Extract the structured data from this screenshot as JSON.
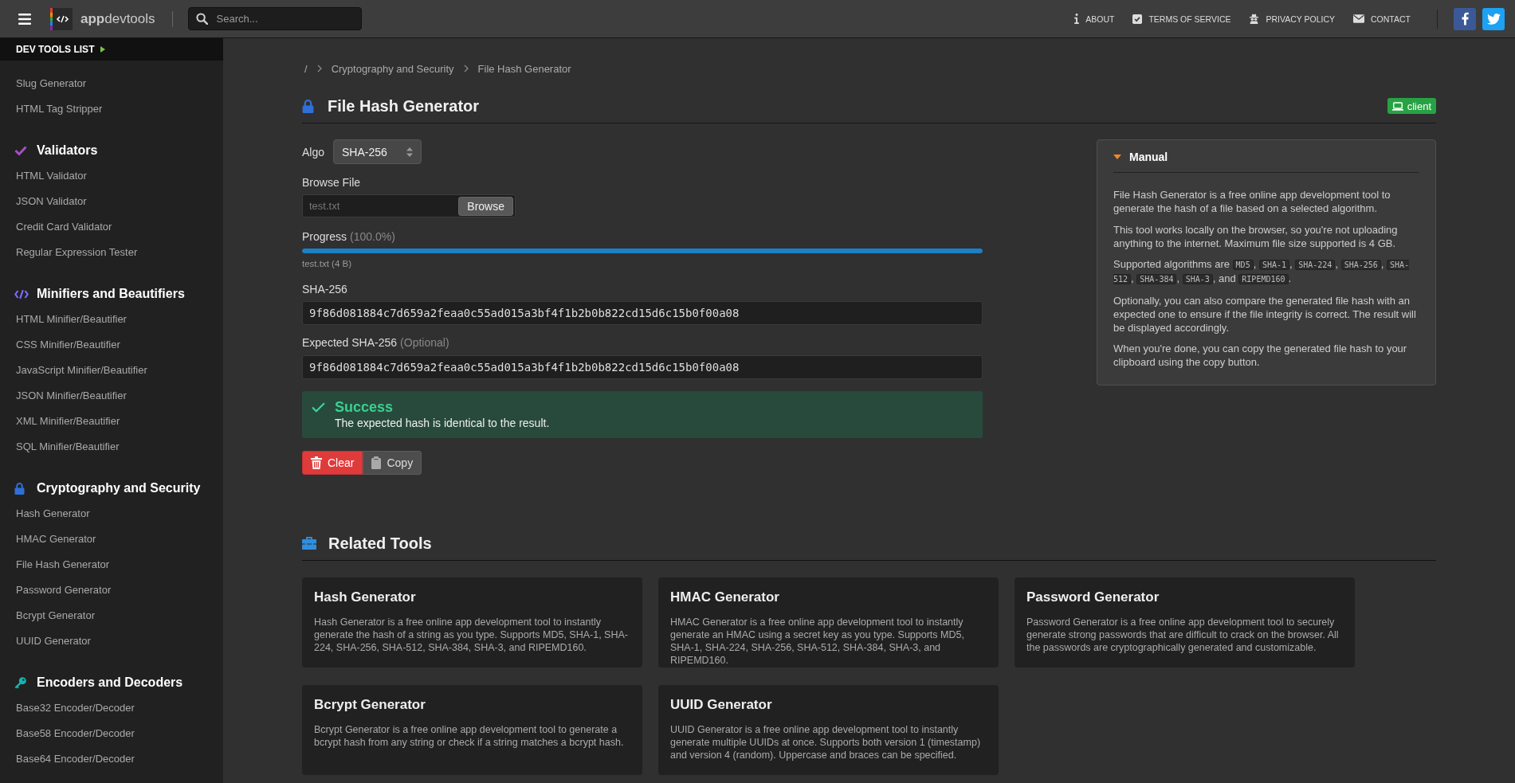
{
  "header": {
    "logo": "**app**devtools",
    "search": {
      "placeholder": "Search..."
    },
    "nav": [
      {
        "kind": "info",
        "label": "ABOUT"
      },
      {
        "kind": "terms",
        "label": "TERMS OF SERVICE"
      },
      {
        "kind": "privacy",
        "label": "PRIVACY POLICY"
      },
      {
        "kind": "contact",
        "label": "CONTACT"
      }
    ],
    "social": [
      {
        "kind": "facebook"
      },
      {
        "kind": "twitter"
      }
    ]
  },
  "sidebar": {
    "title": "DEV TOOLS LIST",
    "groups": [
      {
        "items": [
          "Slug Generator",
          "HTML Tag Stripper"
        ]
      },
      {
        "kind": "check",
        "title": "Validators",
        "items": [
          "HTML Validator",
          "JSON Validator",
          "Credit Card Validator",
          "Regular Expression Tester"
        ]
      },
      {
        "kind": "code",
        "title": "Minifiers and Beautifiers",
        "items": [
          "HTML Minifier/Beautifier",
          "CSS Minifier/Beautifier",
          "JavaScript Minifier/Beautifier",
          "JSON Minifier/Beautifier",
          "XML Minifier/Beautifier",
          "SQL Minifier/Beautifier"
        ]
      },
      {
        "kind": "lock",
        "title": "Cryptography and Security",
        "items": [
          "Hash Generator",
          "HMAC Generator",
          "File Hash Generator",
          "Password Generator",
          "Bcrypt Generator",
          "UUID Generator"
        ]
      },
      {
        "kind": "key",
        "title": "Encoders and Decoders",
        "items": [
          "Base32 Encoder/Decoder",
          "Base58 Encoder/Decoder",
          "Base64 Encoder/Decoder"
        ]
      }
    ]
  },
  "breadcrumb": [
    "/",
    "Cryptography and Security",
    "File Hash Generator"
  ],
  "page": {
    "title": "File Hash Generator",
    "badge": "client"
  },
  "form": {
    "algo": {
      "label": "Algo",
      "value": "SHA-256"
    },
    "file": {
      "label": "Browse File",
      "value": "test.txt",
      "button": "Browse"
    },
    "progress": {
      "label": "Progress",
      "reading": "(100.0%)",
      "level": 1,
      "file_info": "test.txt (4 B)"
    },
    "hash": {
      "label": "SHA-256",
      "value": "9f86d081884c7d659a2feaa0c55ad015a3bf4f1b2b0b822cd15d6c15b0f00a08"
    },
    "expected": {
      "label": "Expected SHA-256",
      "hint": "(Optional)",
      "value": "9f86d081884c7d659a2feaa0c55ad015a3bf4f1b2b0b822cd15d6c15b0f00a08"
    },
    "alert": {
      "kind": "success",
      "title": "Success",
      "message": "The expected hash is identical to the result."
    },
    "buttons": [
      {
        "kind": "clear",
        "label": "Clear"
      },
      {
        "kind": "copy",
        "label": "Copy"
      }
    ]
  },
  "manual": {
    "title": "Manual",
    "expanded": true,
    "paragraphs": [
      [
        {
          "kind": "text",
          "text": "File Hash Generator is a free online app development tool to generate the hash of a file based on a selected algorithm."
        }
      ],
      [
        {
          "kind": "text",
          "text": "This tool works locally on the browser, so you're not uploading anything to the internet. Maximum file size supported is 4 GB."
        }
      ],
      [
        {
          "kind": "text",
          "text": "Supported algorithms are "
        },
        {
          "kind": "code",
          "text": "MD5"
        },
        {
          "kind": "text",
          "text": ", "
        },
        {
          "kind": "code",
          "text": "SHA-1"
        },
        {
          "kind": "text",
          "text": ", "
        },
        {
          "kind": "code",
          "text": "SHA-224"
        },
        {
          "kind": "text",
          "text": ", "
        },
        {
          "kind": "code",
          "text": "SHA-256"
        },
        {
          "kind": "text",
          "text": ", "
        },
        {
          "kind": "code",
          "text": "SHA-512"
        },
        {
          "kind": "text",
          "text": ", "
        },
        {
          "kind": "code",
          "text": "SHA-384"
        },
        {
          "kind": "text",
          "text": ", "
        },
        {
          "kind": "code",
          "text": "SHA-3"
        },
        {
          "kind": "text",
          "text": ", and "
        },
        {
          "kind": "code",
          "text": "RIPEMD160"
        },
        {
          "kind": "text",
          "text": "."
        }
      ],
      [
        {
          "kind": "text",
          "text": "Optionally, you can also compare the generated file hash with an expected one to ensure if the file integrity is correct. The result will be displayed accordingly."
        }
      ],
      [
        {
          "kind": "text",
          "text": "When you're done, you can copy the generated file hash to your clipboard using the copy button."
        }
      ]
    ]
  },
  "related": {
    "title": "Related Tools",
    "cards": [
      {
        "title": "Hash Generator",
        "description": "Hash Generator is a free online app development tool to instantly generate the hash of a string as you type. Supports MD5, SHA-1, SHA-224, SHA-256, SHA-512, SHA-384, SHA-3, and RIPEMD160."
      },
      {
        "title": "HMAC Generator",
        "description": "HMAC Generator is a free online app development tool to instantly generate an HMAC using a secret key as you type. Supports MD5, SHA-1, SHA-224, SHA-256, SHA-512, SHA-384, SHA-3, and RIPEMD160."
      },
      {
        "title": "Password Generator",
        "description": "Password Generator is a free online app development tool to securely generate strong passwords that are difficult to crack on the browser. All the passwords are cryptographically generated and customizable."
      },
      {
        "title": "Bcrypt Generator",
        "description": "Bcrypt Generator is a free online app development tool to generate a bcrypt hash from any string or check if a string matches a bcrypt hash."
      },
      {
        "title": "UUID Generator",
        "description": "UUID Generator is a free online app development tool to instantly generate multiple UUIDs at once. Supports both version 1 (timestamp) and version 4 (random). Uppercase and braces can be specified."
      }
    ]
  }
}
